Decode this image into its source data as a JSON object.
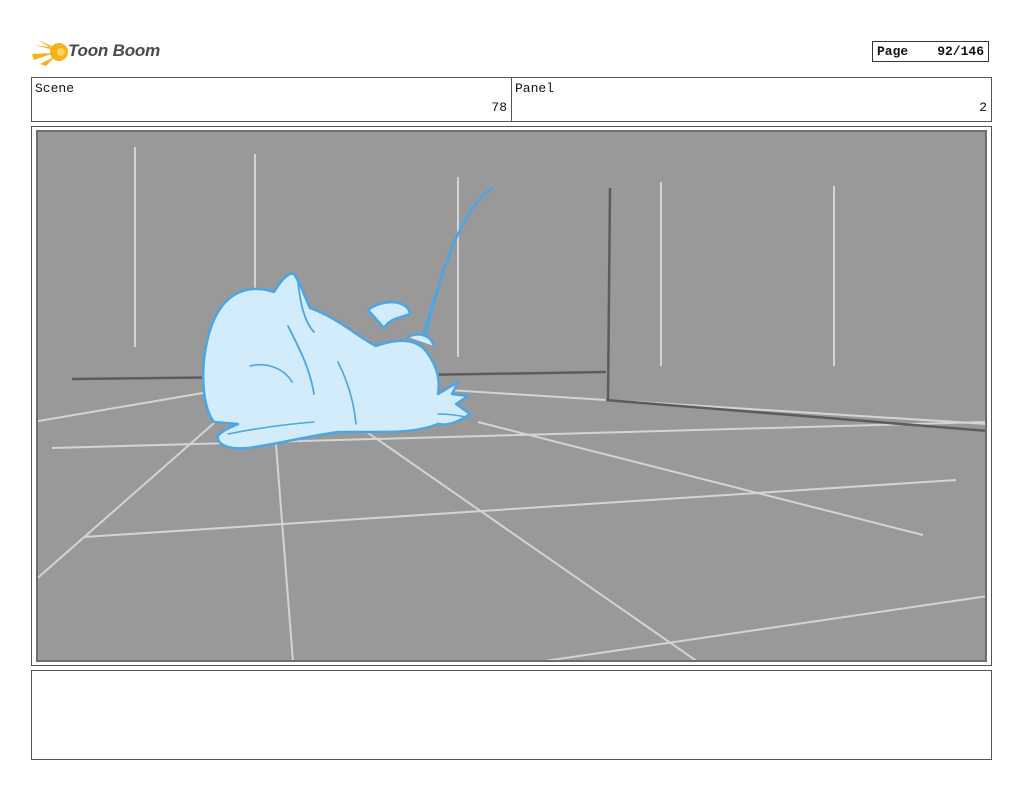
{
  "header": {
    "brand": "Toon Boom",
    "page_label": "Page",
    "page_value": "92/146"
  },
  "panel_info": {
    "scene_label": "Scene",
    "scene_value": "78",
    "panel_label": "Panel",
    "panel_value": "2"
  },
  "notes": {
    "text": ""
  },
  "colors": {
    "background_fill": "#999999",
    "perspective_lines": "#d4d4d4",
    "wall_lines": "#5c5c5c",
    "character_fill": "#d3ecfb",
    "character_outline": "#4aa6e6",
    "logo_yellow": "#f6b21b"
  }
}
